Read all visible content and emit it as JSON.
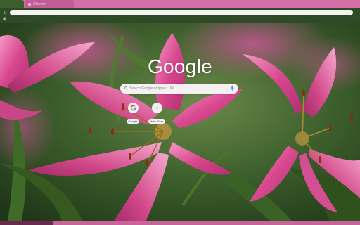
{
  "tabs": [
    {
      "label": ""
    },
    {
      "label": "Chrome"
    }
  ],
  "search": {
    "placeholder": "Search Google or type a URL"
  },
  "logo": {
    "text": "Google"
  },
  "shortcuts": [
    {
      "label": "Google",
      "icon": "google-g-icon"
    },
    {
      "label": "Web Store",
      "icon": "plus-icon"
    }
  ],
  "colors": {
    "tabstrip": "#d36fa6",
    "toolbar": "#2f4a27",
    "accent": "#c9639c"
  }
}
